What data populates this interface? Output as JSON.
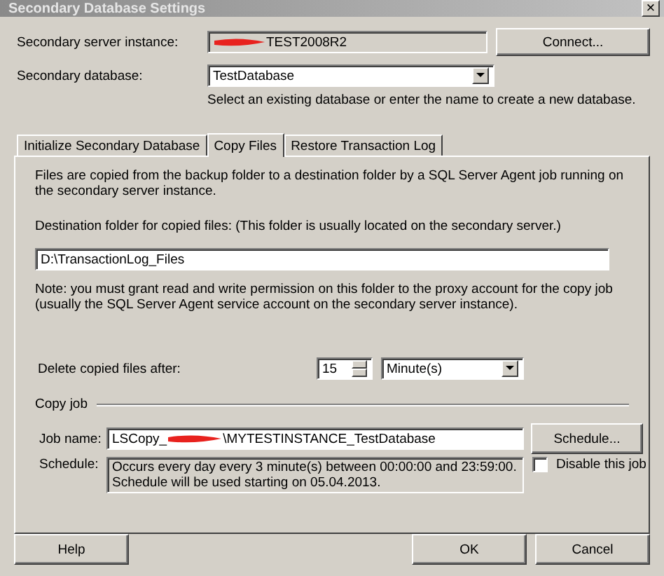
{
  "window": {
    "title": "Secondary Database Settings",
    "close": "×"
  },
  "server_instance": {
    "label": "Secondary server instance:",
    "value": "TEST2008R2",
    "redacted": true,
    "button": "Connect..."
  },
  "secondary_database": {
    "label": "Secondary database:",
    "value": "TestDatabase",
    "hint": "Select an existing database or enter the name to create a new database."
  },
  "tabs": [
    {
      "label": "Initialize Secondary Database",
      "selected": false
    },
    {
      "label": "Copy Files",
      "selected": true
    },
    {
      "label": "Restore Transaction Log",
      "selected": false
    }
  ],
  "copy_files": {
    "intro": "Files are copied from the backup folder to a destination folder by a SQL Server Agent job running on the secondary server instance.",
    "destination_label": "Destination folder for copied files: (This folder is usually located on the secondary server.)",
    "destination_value": "D:\\TransactionLog_Files",
    "note": "Note: you must grant read and write permission on this folder to the proxy account for the copy job (usually the SQL Server Agent service account on the secondary server instance).",
    "delete_label": "Delete copied files after:",
    "delete_value": "15",
    "delete_unit": "Minute(s)",
    "copy_job": {
      "title": "Copy job",
      "job_name_label": "Job name:",
      "job_name_prefix": "LSCopy_",
      "job_name_redacted": true,
      "job_name_suffix": "\\MYTESTINSTANCE_TestDatabase",
      "schedule_button": "Schedule...",
      "schedule_label": "Schedule:",
      "schedule_text": "Occurs every day every 3 minute(s) between 00:00:00 and 23:59:00. Schedule will be used starting on 05.04.2013.",
      "disable_label": "Disable this job",
      "disable_checked": false
    }
  },
  "buttons": [
    {
      "label": "Help"
    },
    {
      "label": "OK"
    },
    {
      "label": "Cancel"
    }
  ]
}
